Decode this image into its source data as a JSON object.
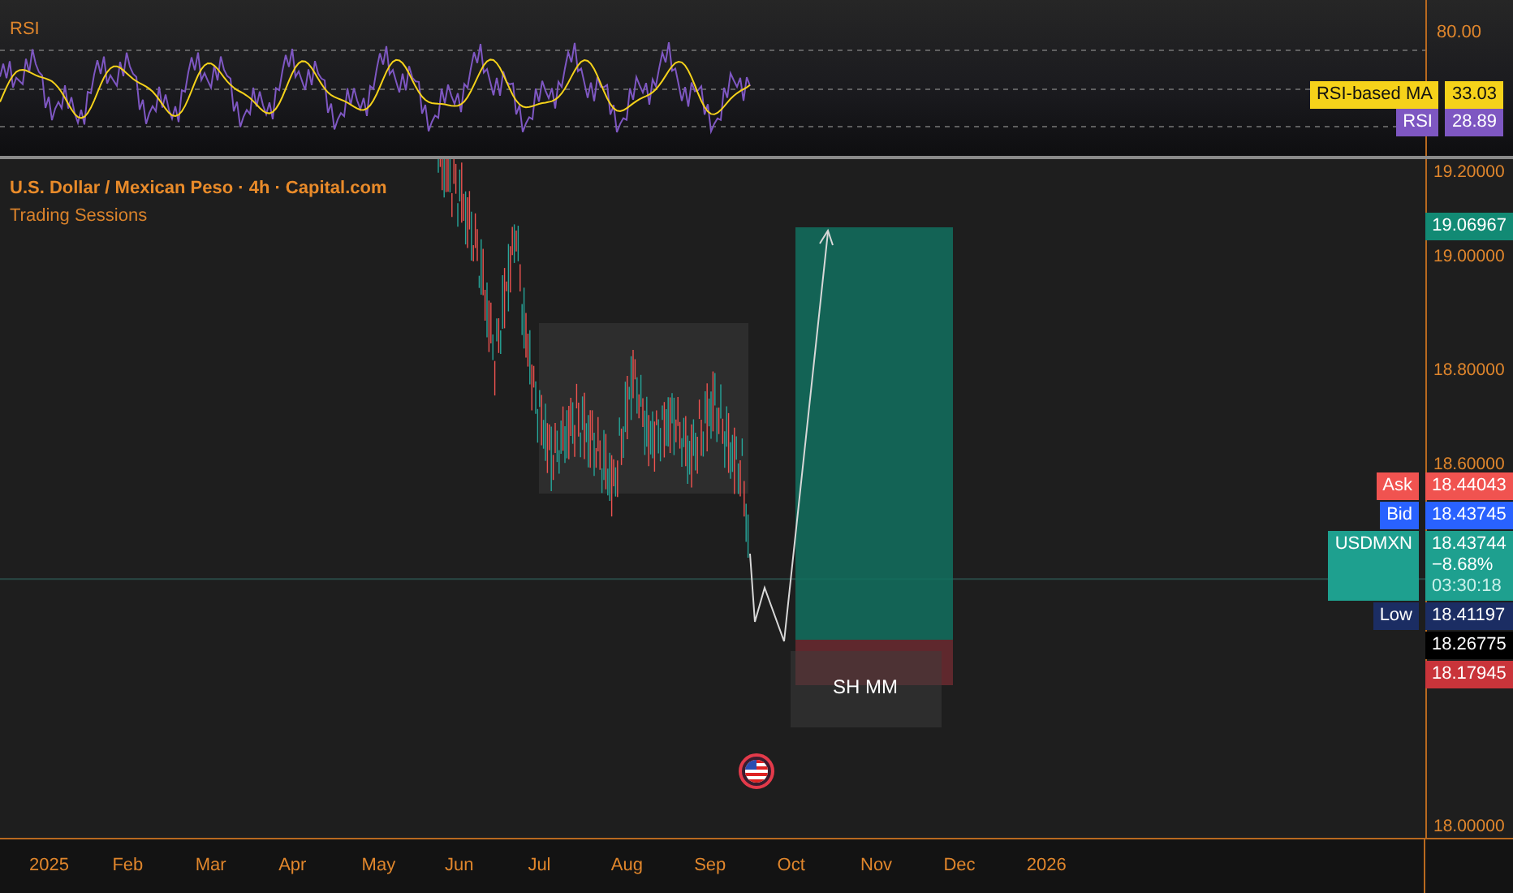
{
  "rsi_pane": {
    "title": "RSI",
    "axis_label": "80.00",
    "ma_tag": {
      "name": "RSI-based MA",
      "value": "33.03"
    },
    "rsi_tag": {
      "name": "RSI",
      "value": "28.89"
    }
  },
  "chart": {
    "title": "U.S. Dollar / Mexican Peso · 4h · Capital.com",
    "indicator": "Trading Sessions",
    "position_label": "SH MM"
  },
  "price_axis": {
    "ticks": [
      "19.20000",
      "19.00000",
      "18.80000",
      "18.60000",
      "18.00000"
    ],
    "target": "19.06967"
  },
  "price_tags": [
    {
      "kind": "ask",
      "name": "Ask",
      "value": "18.44043"
    },
    {
      "kind": "bid",
      "name": "Bid",
      "value": "18.43745"
    },
    {
      "kind": "last",
      "name": "USDMXN",
      "value": "18.43744",
      "change": "−8.68%",
      "countdown": "03:30:18"
    },
    {
      "kind": "low",
      "name": "Low",
      "value": "18.41197"
    },
    {
      "kind": "plain",
      "value": "18.26775"
    },
    {
      "kind": "stop",
      "value": "18.17945"
    }
  ],
  "time_axis": [
    "2025",
    "Feb",
    "Mar",
    "Apr",
    "May",
    "Jun",
    "Jul",
    "Aug",
    "Sep",
    "Oct",
    "Nov",
    "Dec",
    "2026"
  ]
}
